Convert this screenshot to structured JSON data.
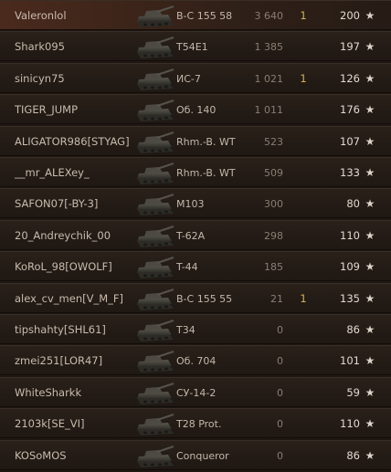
{
  "colors": {
    "row_bg": "#241c16",
    "highlight_bg": "#4a2a1d",
    "text": "#c9bcae",
    "damage": "#8a7e73",
    "kills": "#d6b24a",
    "xp": "#e2dacf"
  },
  "rows": [
    {
      "player": "Valeronlol",
      "tank": "В-С 155 58",
      "damage": "3 640",
      "kills": "1",
      "xp": "200",
      "star": "★",
      "highlight": true
    },
    {
      "player": "Shark095",
      "tank": "T54E1",
      "damage": "1 385",
      "kills": "",
      "xp": "197",
      "star": "★",
      "highlight": false
    },
    {
      "player": "sinicyn75",
      "tank": "ИС-7",
      "damage": "1 021",
      "kills": "1",
      "xp": "126",
      "star": "★",
      "highlight": false
    },
    {
      "player": "TIGER_JUMP",
      "tank": "Об. 140",
      "damage": "1 011",
      "kills": "",
      "xp": "176",
      "star": "★",
      "highlight": false
    },
    {
      "player": "ALIGATOR986[STYAG]",
      "tank": "Rhm.-B. WT",
      "damage": "523",
      "kills": "",
      "xp": "107",
      "star": "★",
      "highlight": false
    },
    {
      "player": "__mr_ALEXey_",
      "tank": "Rhm.-B. WT",
      "damage": "509",
      "kills": "",
      "xp": "133",
      "star": "★",
      "highlight": false
    },
    {
      "player": "SAFON07[-BY-3]",
      "tank": "M103",
      "damage": "300",
      "kills": "",
      "xp": "80",
      "star": "★",
      "highlight": false
    },
    {
      "player": "20_Andreychik_00",
      "tank": "T-62A",
      "damage": "298",
      "kills": "",
      "xp": "110",
      "star": "★",
      "highlight": false
    },
    {
      "player": "KoRoL_98[OWOLF]",
      "tank": "T-44",
      "damage": "185",
      "kills": "",
      "xp": "109",
      "star": "★",
      "highlight": false
    },
    {
      "player": "alex_cv_men[V_M_F]",
      "tank": "В-С 155 55",
      "damage": "21",
      "kills": "1",
      "xp": "135",
      "star": "★",
      "highlight": false
    },
    {
      "player": "tipshahty[SHL61]",
      "tank": "T34",
      "damage": "0",
      "kills": "",
      "xp": "86",
      "star": "★",
      "highlight": false
    },
    {
      "player": "zmei251[LOR47]",
      "tank": "Об. 704",
      "damage": "0",
      "kills": "",
      "xp": "101",
      "star": "★",
      "highlight": false
    },
    {
      "player": "WhiteSharkk",
      "tank": "СУ-14-2",
      "damage": "0",
      "kills": "",
      "xp": "59",
      "star": "★",
      "highlight": false
    },
    {
      "player": "2103k[SE_VI]",
      "tank": "T28 Prot.",
      "damage": "0",
      "kills": "",
      "xp": "110",
      "star": "★",
      "highlight": false
    },
    {
      "player": "KOSoMOS",
      "tank": "Conqueror",
      "damage": "0",
      "kills": "",
      "xp": "86",
      "star": "★",
      "highlight": false
    }
  ]
}
